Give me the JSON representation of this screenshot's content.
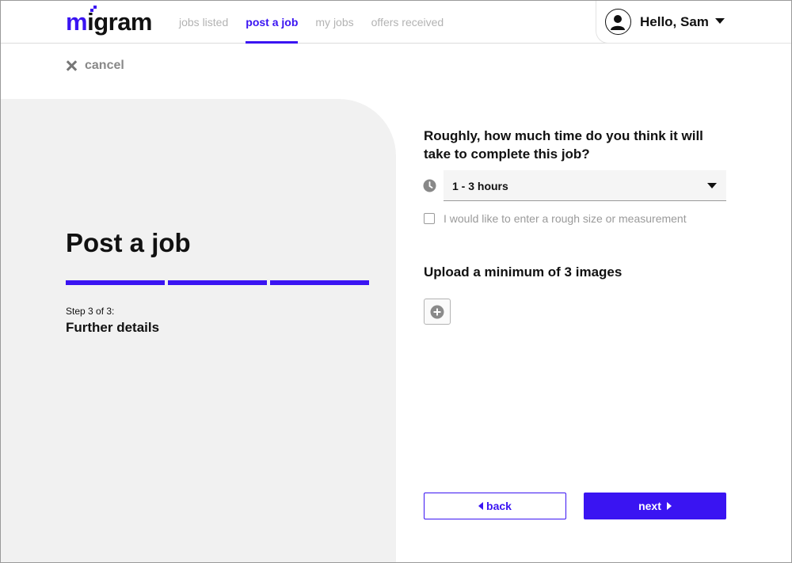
{
  "header": {
    "logo": {
      "text_accent": "m",
      "text_rest": "igram"
    },
    "nav": [
      {
        "label": "jobs listed",
        "active": false
      },
      {
        "label": "post a job",
        "active": true
      },
      {
        "label": "my jobs",
        "active": false
      },
      {
        "label": "offers received",
        "active": false
      }
    ],
    "user": {
      "greeting": "Hello, Sam",
      "avatar_icon": "user-icon",
      "menu_icon": "caret-down-icon"
    }
  },
  "cancel": {
    "label": "cancel",
    "icon": "close-icon"
  },
  "left": {
    "title": "Post a job",
    "progress": {
      "segments": 3,
      "completed": 3
    },
    "step_label": "Step 3 of 3:",
    "step_name": "Further details"
  },
  "form": {
    "question": "Roughly, how much time do you think it will take to complete this job?",
    "time_select": {
      "value": "1 - 3 hours",
      "icon": "clock-icon"
    },
    "size_checkbox": {
      "label": "I would like to enter a rough size or measurement",
      "checked": false
    },
    "upload": {
      "title": "Upload a minimum of 3 images",
      "icon": "plus-circle-icon"
    }
  },
  "actions": {
    "back_label": "back",
    "next_label": "next"
  },
  "colors": {
    "accent": "#3a14f2",
    "panel": "#f1f1f1",
    "muted": "#9a9a9a"
  }
}
